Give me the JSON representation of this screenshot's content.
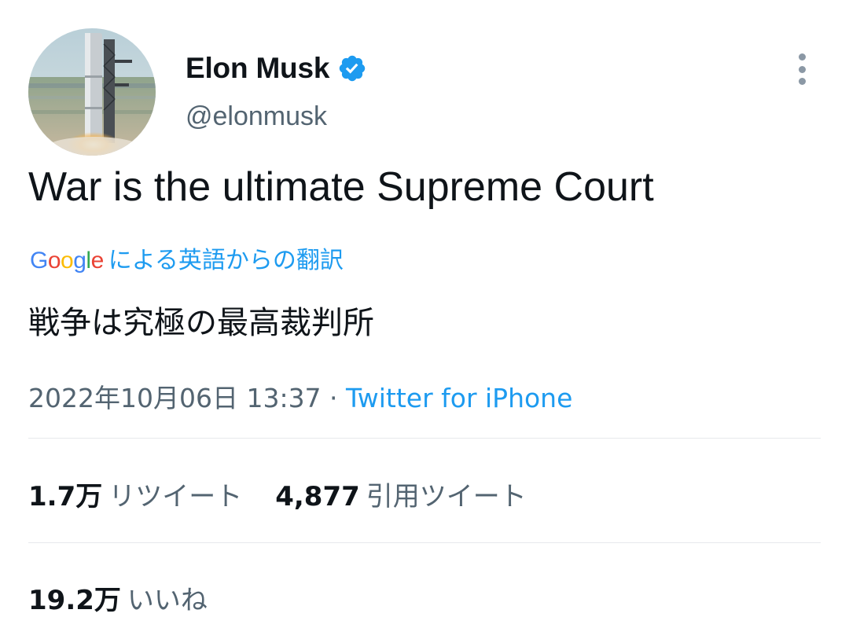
{
  "author": {
    "display_name": "Elon Musk",
    "handle": "@elonmusk",
    "verified": true
  },
  "tweet": {
    "text": "War is the ultimate Supreme Court"
  },
  "translation": {
    "provider_logo": [
      "G",
      "o",
      "o",
      "g",
      "l",
      "e"
    ],
    "label": "による英語からの翻訳",
    "text": "戦争は究極の最高裁判所"
  },
  "meta": {
    "timestamp": "2022年10月06日 13:37",
    "separator": " · ",
    "source": "Twitter for iPhone"
  },
  "stats": {
    "retweets": {
      "count": "1.7万",
      "label": "リツイート"
    },
    "quotes": {
      "count": "4,877",
      "label": "引用ツイート"
    },
    "likes": {
      "count": "19.2万",
      "label": "いいね"
    }
  },
  "colors": {
    "accent": "#1d9bf0",
    "text": "#0f1419",
    "secondary": "#536471",
    "divider": "#e7e9ec",
    "google_blue": "#4285f4",
    "google_red": "#ea4335",
    "google_yellow": "#fbbc05",
    "google_green": "#34a853"
  },
  "icons": {
    "verified": "verified-badge-icon",
    "more": "more-vertical-icon"
  }
}
